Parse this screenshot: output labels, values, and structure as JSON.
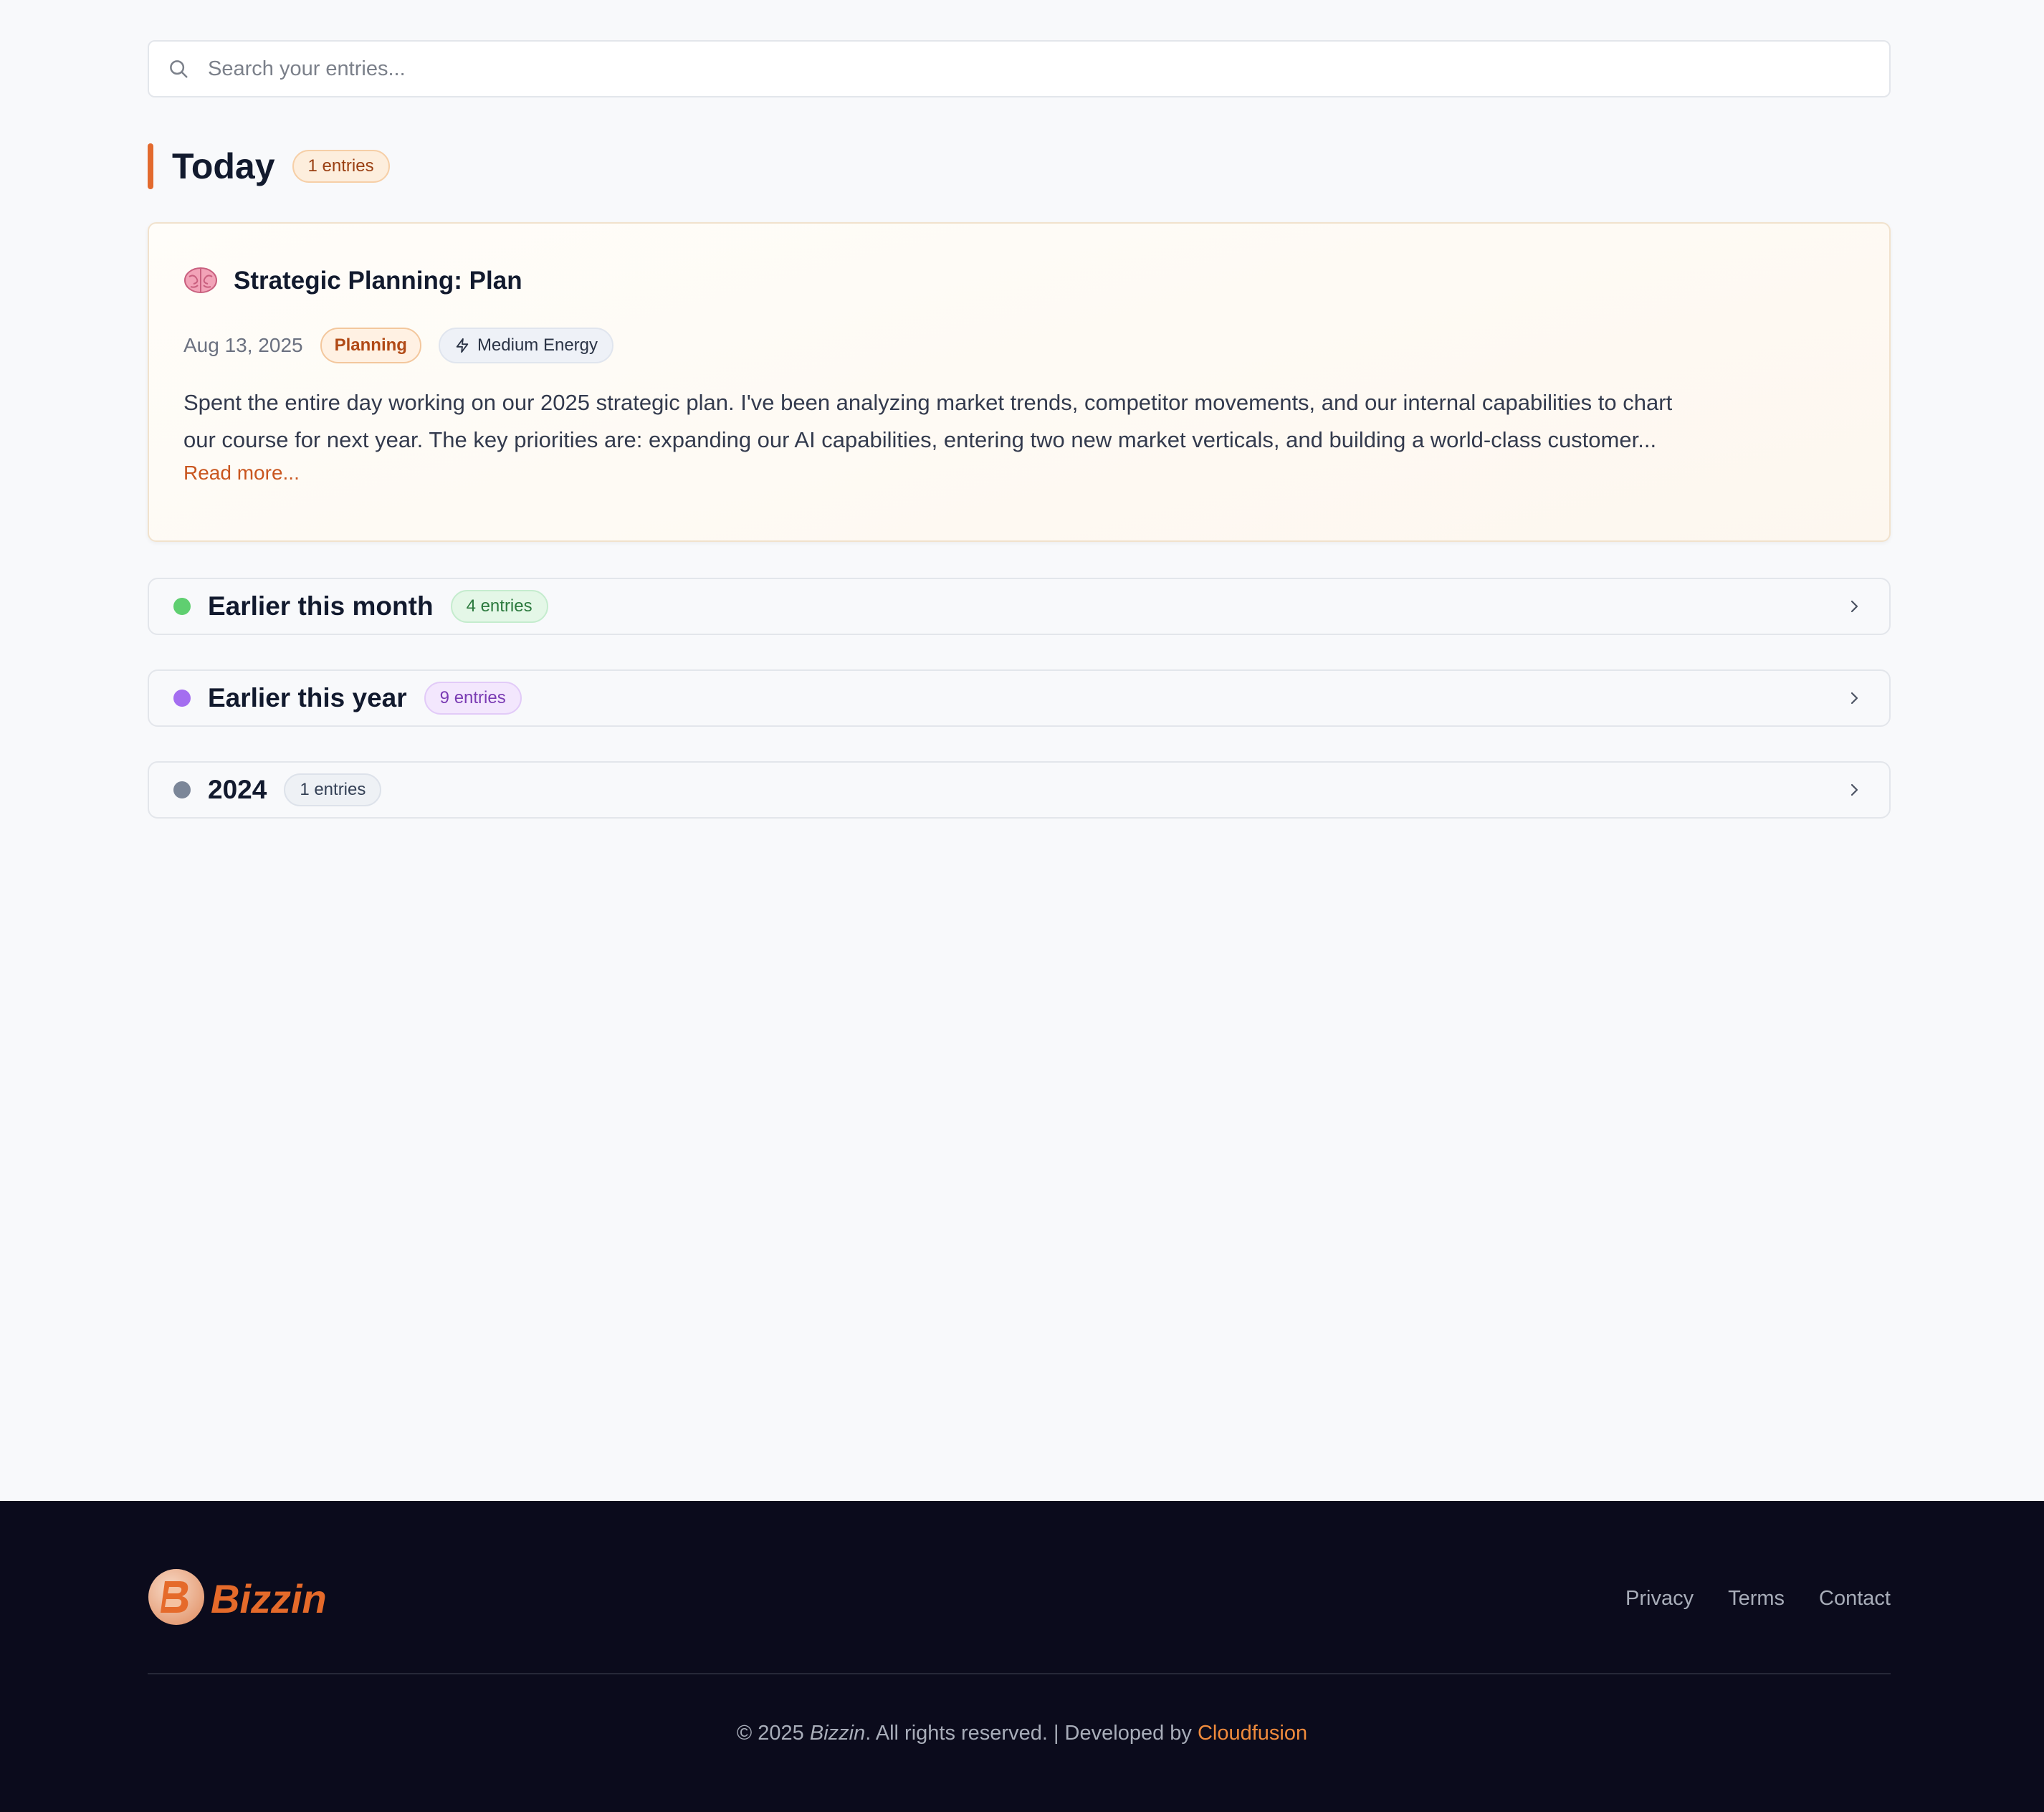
{
  "search": {
    "placeholder": "Search your entries..."
  },
  "today": {
    "title": "Today",
    "count_label": "1 entries",
    "accent_color": "#e36a2e"
  },
  "entry": {
    "icon": "brain-icon",
    "title": "Strategic Planning: Plan",
    "date": "Aug 13, 2025",
    "category": "Planning",
    "energy": "Medium Energy",
    "excerpt_line1": "Spent the entire day working on our 2025 strategic plan. I've been analyzing market trends, competitor movements, and our internal capabilities to chart",
    "excerpt_line2": "our course for next year. The key priorities are: expanding our AI capabilities, entering two new market verticals, and building a world-class customer...",
    "read_more": "Read more..."
  },
  "groups": [
    {
      "title": "Earlier this month",
      "count_label": "4 entries",
      "dot_color": "#5fcf70"
    },
    {
      "title": "Earlier this year",
      "count_label": "9 entries",
      "dot_color": "#a46ef0"
    },
    {
      "title": "2024",
      "count_label": "1 entries",
      "dot_color": "#7b8698"
    }
  ],
  "footer": {
    "brand": "Bizzin",
    "links": [
      "Privacy",
      "Terms",
      "Contact"
    ],
    "copyright_prefix": "© 2025",
    "copyright_brand": "Bizzin",
    "copyright_suffix": ". All rights reserved. | Developed by",
    "developer": "Cloudfusion",
    "developer_color": "#f08b3c"
  }
}
